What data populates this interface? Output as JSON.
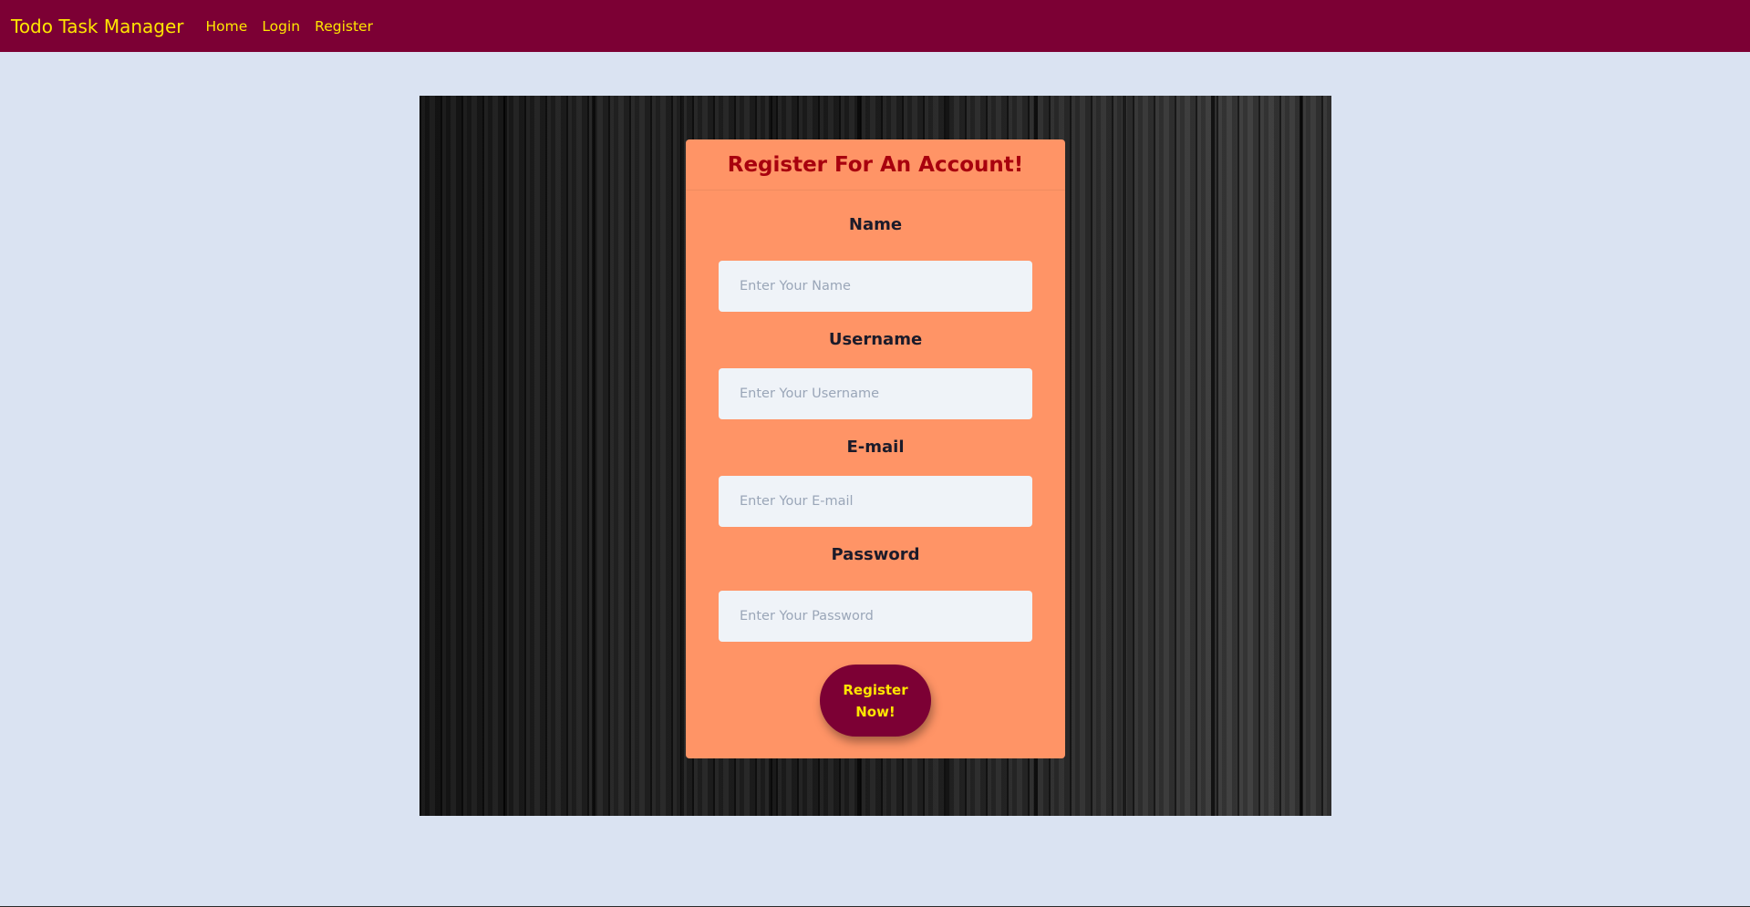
{
  "navbar": {
    "brand": "Todo Task Manager",
    "links": [
      "Home",
      "Login",
      "Register"
    ],
    "background_color": "#7c0034",
    "text_color": "#ffe600"
  },
  "form": {
    "title": "Register For An Account!",
    "fields": [
      {
        "label": "Name",
        "placeholder": "Enter Your Name",
        "value": ""
      },
      {
        "label": "Username",
        "placeholder": "Enter Your Username",
        "value": ""
      },
      {
        "label": "E-mail",
        "placeholder": "Enter Your E-mail",
        "value": ""
      },
      {
        "label": "Password",
        "placeholder": "Enter Your Password",
        "value": ""
      }
    ],
    "submit_label": "Register Now!",
    "card_color": "#ff9466",
    "title_color": "#a8000e"
  },
  "page": {
    "background_color": "#dae3f2"
  }
}
